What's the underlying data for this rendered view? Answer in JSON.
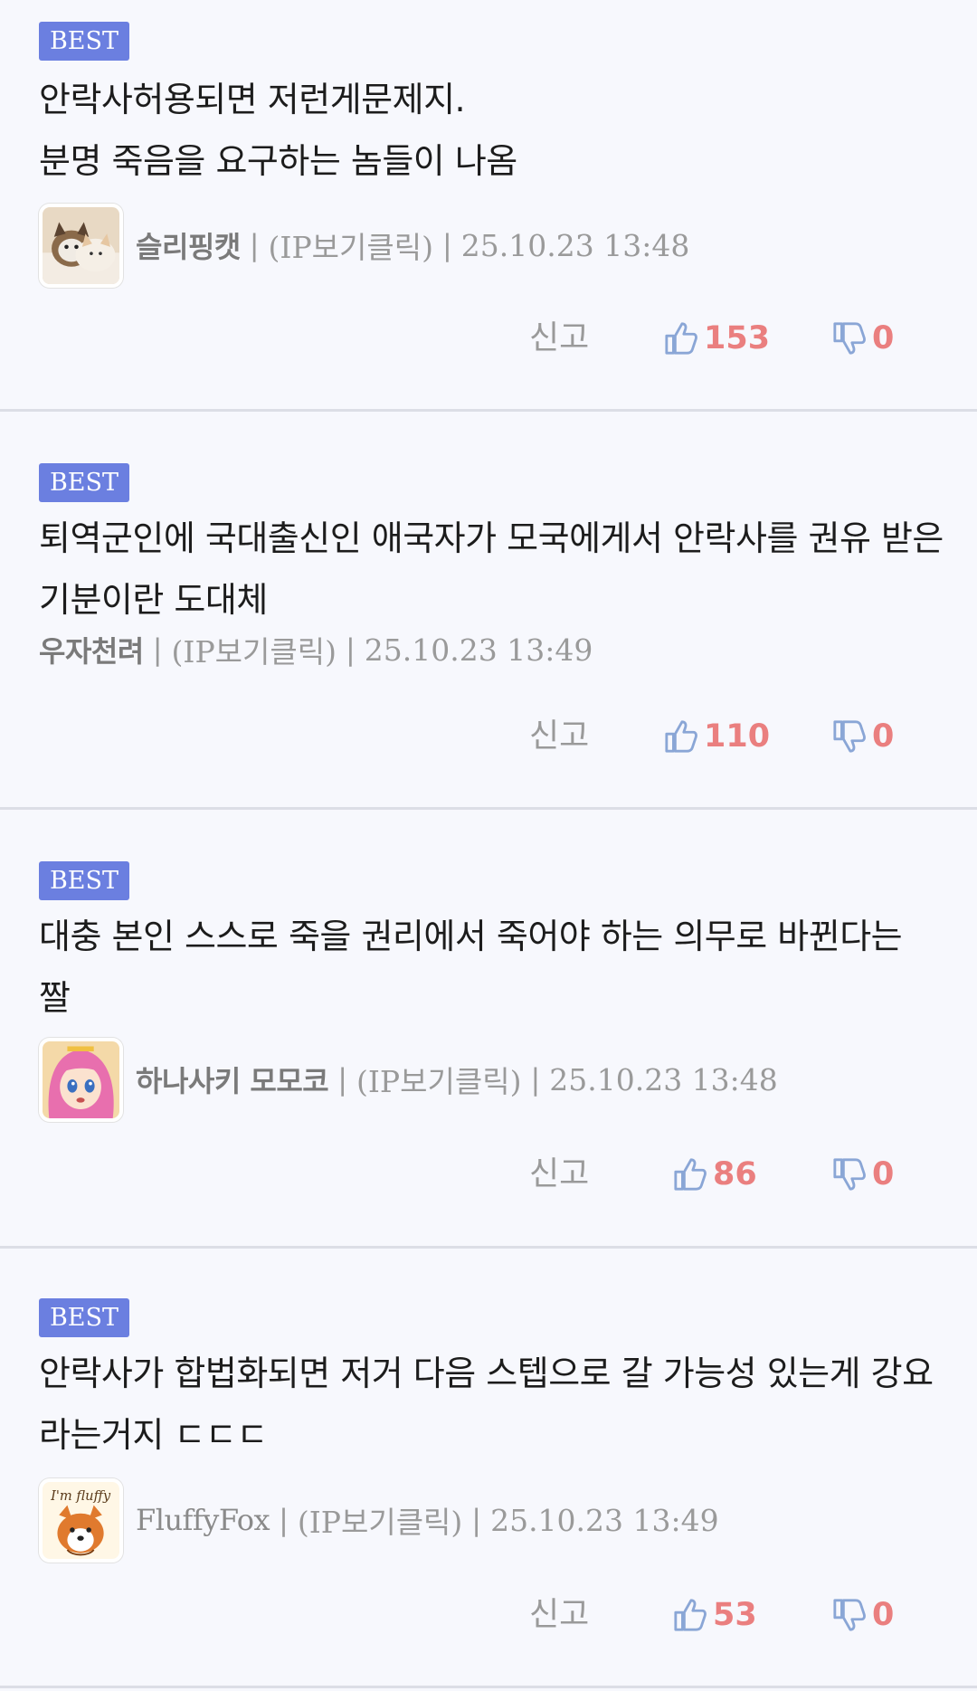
{
  "labels": {
    "report": "신고",
    "ip": "(IP보기클릭)",
    "separator": "|"
  },
  "comments": [
    {
      "badge": "BEST",
      "text": "안락사허용되면 저런게문제지.\n분명 죽음을 요구하는 놈들이 나옴",
      "nickname": "슬리핑캣",
      "avatar": "cat-photo",
      "date": "25.10.23 13:48",
      "likes": "153",
      "dislikes": "0"
    },
    {
      "badge": "BEST",
      "text": "퇴역군인에 국대출신인 애국자가 모국에게서 안락사를 권유 받은 기분이란 도대체",
      "nickname": "우자천려",
      "avatar": "",
      "date": "25.10.23 13:49",
      "likes": "110",
      "dislikes": "0"
    },
    {
      "badge": "BEST",
      "text": "대충 본인 스스로 죽을 권리에서 죽어야 하는 의무로 바뀐다는 짤",
      "nickname": "하나사키 모모코",
      "avatar": "anime-girl",
      "date": "25.10.23 13:48",
      "likes": "86",
      "dislikes": "0"
    },
    {
      "badge": "BEST",
      "text": "안락사가 합법화되면 저거 다음 스텝으로 갈 가능성 있는게 강요라는거지 ㄷㄷㄷ",
      "nickname": "FluffyFox",
      "avatar": "fox-im-fluffy",
      "avatar_caption": "I'm fluffy",
      "date": "25.10.23 13:49",
      "likes": "53",
      "dislikes": "0"
    }
  ],
  "colors": {
    "background": "#f7f8fd",
    "badge": "#6b7fe0",
    "like_count": "#ea7f7f",
    "thumb_icon": "#8aa6d6",
    "divider": "#dcdee6"
  },
  "icons": {
    "like": "thumbs-up-icon",
    "dislike": "thumbs-down-icon"
  }
}
